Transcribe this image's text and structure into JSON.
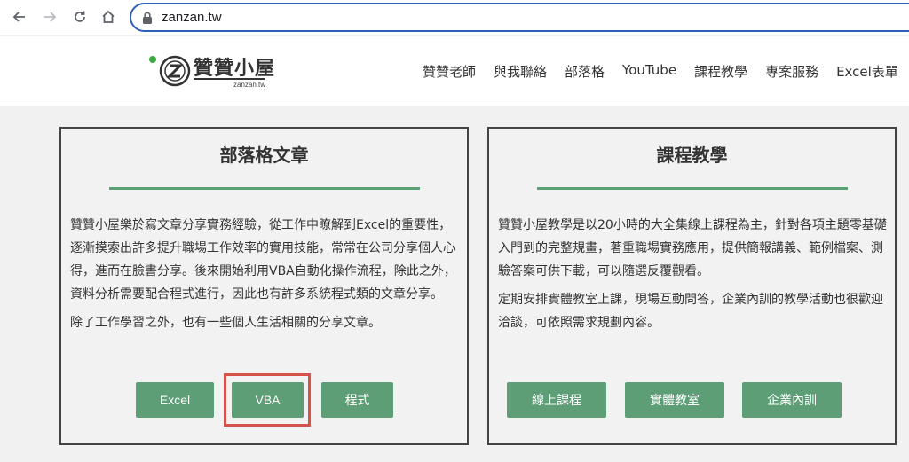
{
  "browser": {
    "url": "zanzan.tw"
  },
  "site": {
    "logo_title": "贊贊小屋",
    "logo_sub": "zanzan.tw",
    "nav": [
      "贊贊老師",
      "與我聯絡",
      "部落格",
      "YouTube",
      "課程教學",
      "專案服務",
      "Excel表單"
    ]
  },
  "blog_card": {
    "title": "部落格文章",
    "paragraphs": [
      "贊贊小屋樂於寫文章分享實務經驗，從工作中瞭解到Excel的重要性，逐漸摸索出許多提升職場工作效率的實用技能，常常在公司分享個人心得，進而在臉書分享。後來開始利用VBA自動化操作流程，除此之外，資料分析需要配合程式進行，因此也有許多系統程式類的文章分享。",
      "除了工作學習之外，也有一些個人生活相關的分享文章。"
    ],
    "buttons": [
      "Excel",
      "VBA",
      "程式"
    ]
  },
  "course_card": {
    "title": "課程教學",
    "paragraphs": [
      "贊贊小屋教學是以20小時的大全集線上課程為主，針對各項主題零基礎入門到的完整規畫，著重職場實務應用，提供簡報講義、範例檔案、測驗答案可供下載，可以隨選反覆觀看。",
      "定期安排實體教室上課，現場互動問答，企業內訓的教學活動也很歡迎洽談，可依照需求規劃內容。"
    ],
    "buttons": [
      "線上課程",
      "實體教室",
      "企業內訓"
    ]
  },
  "colors": {
    "accent_green": "#5d9e76",
    "highlight_red": "#d6524a",
    "address_border": "#2f5fb7"
  }
}
